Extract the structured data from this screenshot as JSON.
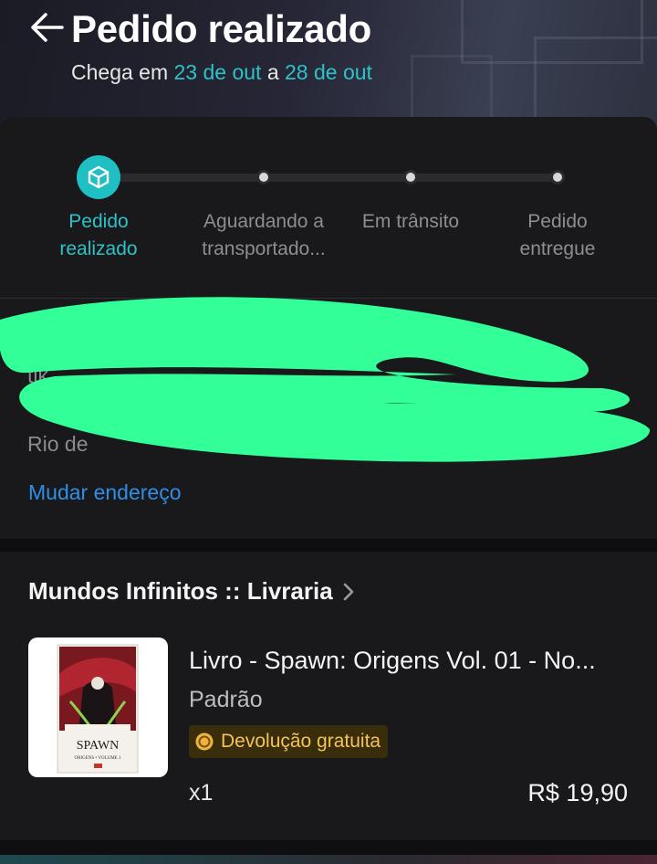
{
  "header": {
    "title": "Pedido realizado",
    "eta_prefix": "Chega em",
    "eta_start": "23 de out",
    "eta_sep": "a",
    "eta_end": "28 de out"
  },
  "progress": {
    "steps": [
      {
        "line1": "Pedido",
        "line2": "realizado",
        "state": "active"
      },
      {
        "line1": "Aguardando a",
        "line2": "transportado...",
        "state": "pending"
      },
      {
        "line1": "Em trânsito",
        "line2": "",
        "state": "pending"
      },
      {
        "line1": "Pedido",
        "line2": "entregue",
        "state": "pending"
      }
    ]
  },
  "address": {
    "line1_visible": "tik",
    "line2_visible": "Rio de",
    "change_label": "Mudar endereço",
    "redaction_color": "#33ff99"
  },
  "order": {
    "shop_name": "Mundos Infinitos :: Livraria",
    "product_title": "Livro - Spawn: Origens Vol. 01 - No...",
    "variant": "Padrão",
    "badge": "Devolução gratuita",
    "quantity": "x1",
    "price": "R$ 19,90",
    "cover": {
      "title": "SPAWN",
      "subtitle": "ORIGENS • VOLUME 1"
    }
  },
  "colors": {
    "accent": "#2cc3c8",
    "link": "#2f8ee6",
    "badge_text": "#f2c35a"
  }
}
